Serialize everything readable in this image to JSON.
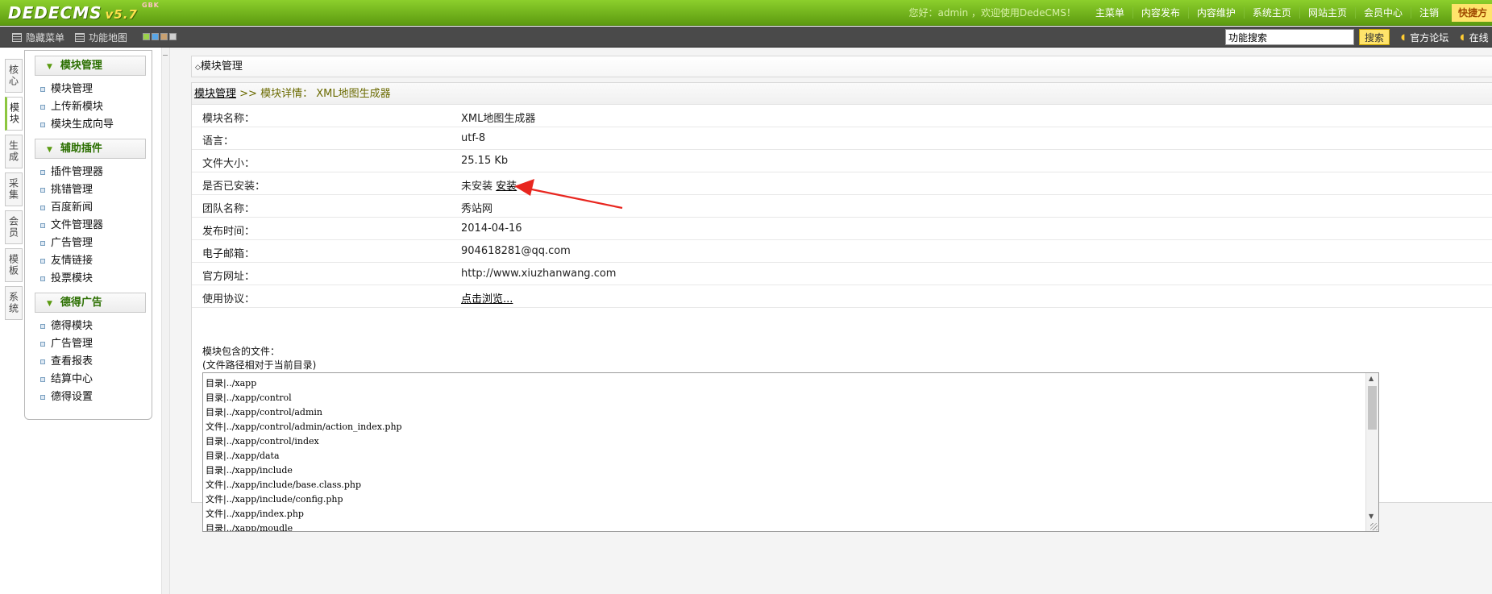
{
  "header": {
    "logo": "DEDECMS",
    "version": "v5.7",
    "version_tag": "GBK",
    "welcome": "您好：admin ，欢迎使用DedeCMS！",
    "nav": [
      "主菜单",
      "内容发布",
      "内容维护",
      "系统主页",
      "网站主页",
      "会员中心",
      "注销"
    ],
    "quick": "快捷方"
  },
  "subbar": {
    "hide_menu": "隐藏菜单",
    "site_map": "功能地图",
    "swatches": [
      "#9bd24a",
      "#58a6e6",
      "#c8a070",
      "#cfcfcf"
    ],
    "search_value": "功能搜索",
    "search_button": "搜索",
    "forum": "官方论坛",
    "online": "在线"
  },
  "vtabs": [
    "核心",
    "模块",
    "生成",
    "采集",
    "会员",
    "模板",
    "系统"
  ],
  "menu": {
    "sections": [
      {
        "title": "模块管理",
        "items": [
          "模块管理",
          "上传新模块",
          "模块生成向导"
        ]
      },
      {
        "title": "辅助插件",
        "items": [
          "插件管理器",
          "挑错管理",
          "百度新闻",
          "文件管理器",
          "广告管理",
          "友情链接",
          "投票模块"
        ]
      },
      {
        "title": "德得广告",
        "items": [
          "德得模块",
          "广告管理",
          "查看报表",
          "结算中心",
          "德得设置"
        ]
      }
    ]
  },
  "main": {
    "title": "模块管理",
    "crumb_link": "模块管理",
    "crumb_sep": " >> ",
    "crumb_text": "模块详情： XML地图生成器",
    "rows": [
      {
        "label": "模块名称：",
        "value": "XML地图生成器"
      },
      {
        "label": "语言：",
        "value": "utf-8"
      },
      {
        "label": "文件大小：",
        "value": "25.15 Kb"
      },
      {
        "label": "是否已安装：",
        "value": "未安装",
        "link": "安装"
      },
      {
        "label": "团队名称：",
        "value": "秀站网"
      },
      {
        "label": "发布时间：",
        "value": "2014-04-16"
      },
      {
        "label": "电子邮箱：",
        "value": "904618281@qq.com"
      },
      {
        "label": "官方网址：",
        "value": "http://www.xiuzhanwang.com"
      },
      {
        "label": "使用协议：",
        "link": "点击浏览..."
      }
    ],
    "files_label": "模块包含的文件：",
    "files_note": "(文件路径相对于当前目录)",
    "files": [
      "目录|../xapp",
      "目录|../xapp/control",
      "目录|../xapp/control/admin",
      "文件|../xapp/control/admin/action_index.php",
      "目录|../xapp/control/index",
      "目录|../xapp/data",
      "目录|../xapp/include",
      "文件|../xapp/include/base.class.php",
      "文件|../xapp/include/config.php",
      "文件|../xapp/index.php",
      "目录|../xapp/moudle"
    ]
  },
  "colors": {
    "header_green": "#6aab18",
    "menu_green": "#2b6f00",
    "arrow_red": "#e8261f"
  }
}
